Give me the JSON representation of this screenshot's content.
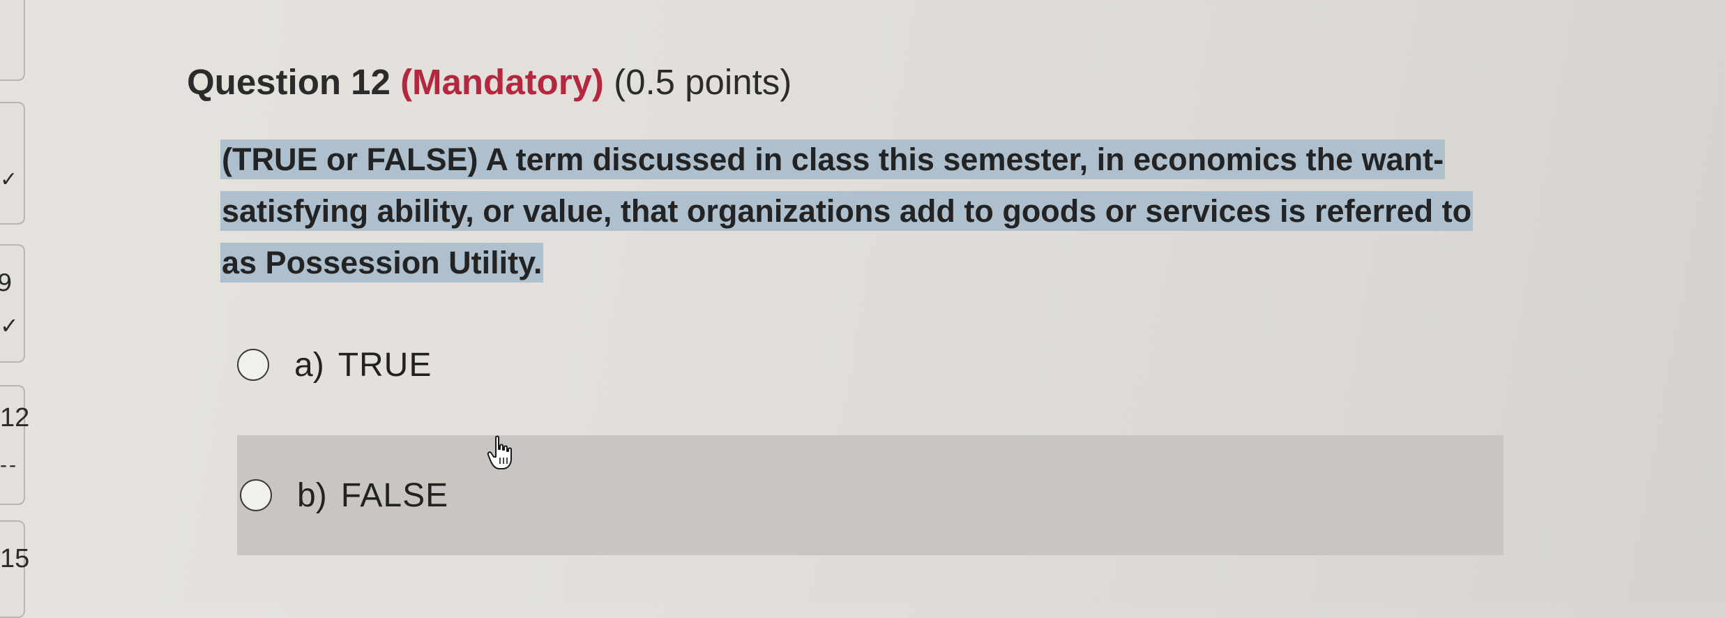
{
  "question": {
    "title_prefix": "Question 12",
    "mandatory": "(Mandatory)",
    "points": "(0.5 points)",
    "text": "(TRUE or FALSE) A term discussed in class this semester, in economics the want-satisfying ability, or value, that organizations add to goods or services is referred to as Possession Utility."
  },
  "options": [
    {
      "letter": "a)",
      "label": "TRUE",
      "selected": false
    },
    {
      "letter": "b)",
      "label": "FALSE",
      "selected": false
    }
  ],
  "navigator": {
    "visible_numbers": [
      "12",
      "15"
    ],
    "partial_digit": "9"
  },
  "colors": {
    "mandatory": "#b3283e",
    "selection_highlight": "#aebfcd",
    "hover_option_bg": "#c9c6c1",
    "page_bg": "#e2dfda"
  },
  "icons": {
    "answered_mark": "checkmark-icon",
    "cursor": "hand-pointer-icon",
    "radio": "radio-circle-icon"
  }
}
